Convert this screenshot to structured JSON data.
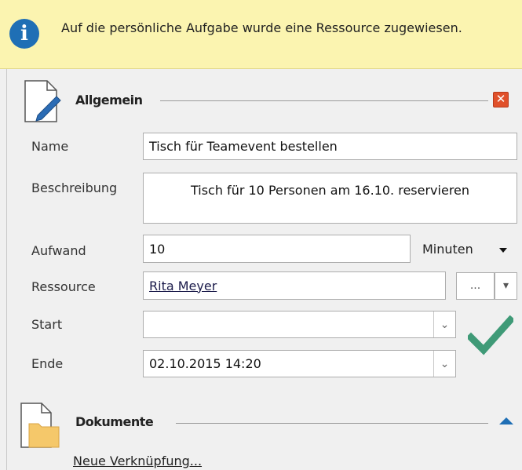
{
  "info": {
    "icon": "info-icon",
    "message": "Auf die persönliche Aufgabe wurde eine Ressource zugewiesen."
  },
  "allgemein": {
    "title": "Allgemein",
    "fields": {
      "name": {
        "label": "Name",
        "value": "Tisch für Teamevent bestellen"
      },
      "beschreibung": {
        "label": "Beschreibung",
        "value": "Tisch für 10 Personen am 16.10. reservieren"
      },
      "aufwand": {
        "label": "Aufwand",
        "value": "10",
        "unit": "Minuten"
      },
      "ressource": {
        "label": "Ressource",
        "value": "Rita Meyer",
        "browse_label": "..."
      },
      "start": {
        "label": "Start",
        "value": ""
      },
      "ende": {
        "label": "Ende",
        "value": "02.10.2015 14:20"
      }
    }
  },
  "dokumente": {
    "title": "Dokumente",
    "new_link_label": "Neue Verknüpfung..."
  },
  "colors": {
    "info_bg": "#fbf4b0",
    "info_icon": "#1f6fb5",
    "close": "#e0502a",
    "check": "#3f9a77"
  }
}
